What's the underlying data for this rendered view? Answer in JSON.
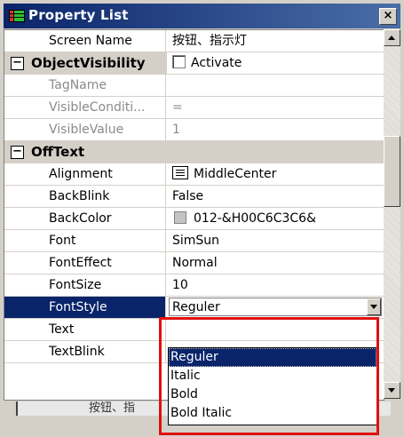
{
  "window": {
    "title": "Property List",
    "close_label": "×"
  },
  "rows": [
    {
      "name": "Screen Name",
      "value": "按钮、指示灯"
    },
    {
      "category": "ObjectVisibility",
      "value": "Activate"
    },
    {
      "name": "TagName",
      "value": ""
    },
    {
      "name": "VisibleConditi...",
      "value": "="
    },
    {
      "name": "VisibleValue",
      "value": "1"
    },
    {
      "category": "OffText"
    },
    {
      "name": "Alignment",
      "value": "MiddleCenter"
    },
    {
      "name": "BackBlink",
      "value": "False"
    },
    {
      "name": "BackColor",
      "value": "012-&H00C6C3C6&"
    },
    {
      "name": "Font",
      "value": "SimSun"
    },
    {
      "name": "FontEffect",
      "value": "Normal"
    },
    {
      "name": "FontSize",
      "value": "10"
    },
    {
      "name": "FontStyle",
      "value": "Reguler"
    },
    {
      "name": "Text",
      "value": ""
    },
    {
      "name": "TextBlink",
      "value": ""
    }
  ],
  "dropdown_options": [
    "Reguler",
    "Italic",
    "Bold",
    "Bold Italic"
  ],
  "background_text": "按钮、指",
  "colors": {
    "selection": "#0a246a",
    "highlight_box": "#e01010",
    "backcolor_swatch": "#c6c3c6"
  }
}
